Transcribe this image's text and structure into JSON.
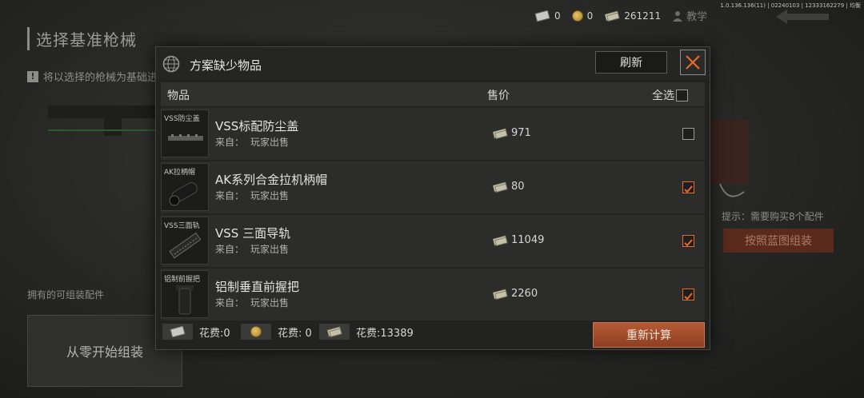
{
  "version": "1.0.136.136(11) | 02240103 | 12333162279 | 均衡",
  "background": {
    "title": "选择基准枪械",
    "notice": "将以选择的枪械为基础进",
    "owned_label": "拥有的可组装配件",
    "assemble_button": "从零开始组装",
    "hint": "提示：需要购买8个配件",
    "blueprint_button": "按照蓝图组装"
  },
  "currency": {
    "voucher": "0",
    "coin": "0",
    "cash": "261211",
    "tutorial": "教学"
  },
  "modal": {
    "title": "方案缺少物品",
    "refresh": "刷新",
    "columns": {
      "item": "物品",
      "price": "售价",
      "select_all": "全选"
    },
    "source_prefix": "来自：",
    "items": [
      {
        "thumb_label": "VSS防尘盖",
        "name": "VSS标配防尘盖",
        "source": "玩家出售",
        "price": "971",
        "checked": false
      },
      {
        "thumb_label": "AK拉柄帽",
        "name": "AK系列合金拉机柄帽",
        "source": "玩家出售",
        "price": "80",
        "checked": true
      },
      {
        "thumb_label": "VSS三面轨",
        "name": "VSS 三面导轨",
        "source": "玩家出售",
        "price": "11049",
        "checked": true
      },
      {
        "thumb_label": "铝制前握把",
        "name": "铝制垂直前握把",
        "source": "玩家出售",
        "price": "2260",
        "checked": true
      }
    ],
    "footer": {
      "voucher_cost": "花费:0",
      "coin_cost": "花费: 0",
      "cash_cost": "花费:13389",
      "recalc": "重新计算"
    }
  },
  "colors": {
    "accent": "#e46a2e",
    "button": "#a24c2b"
  }
}
